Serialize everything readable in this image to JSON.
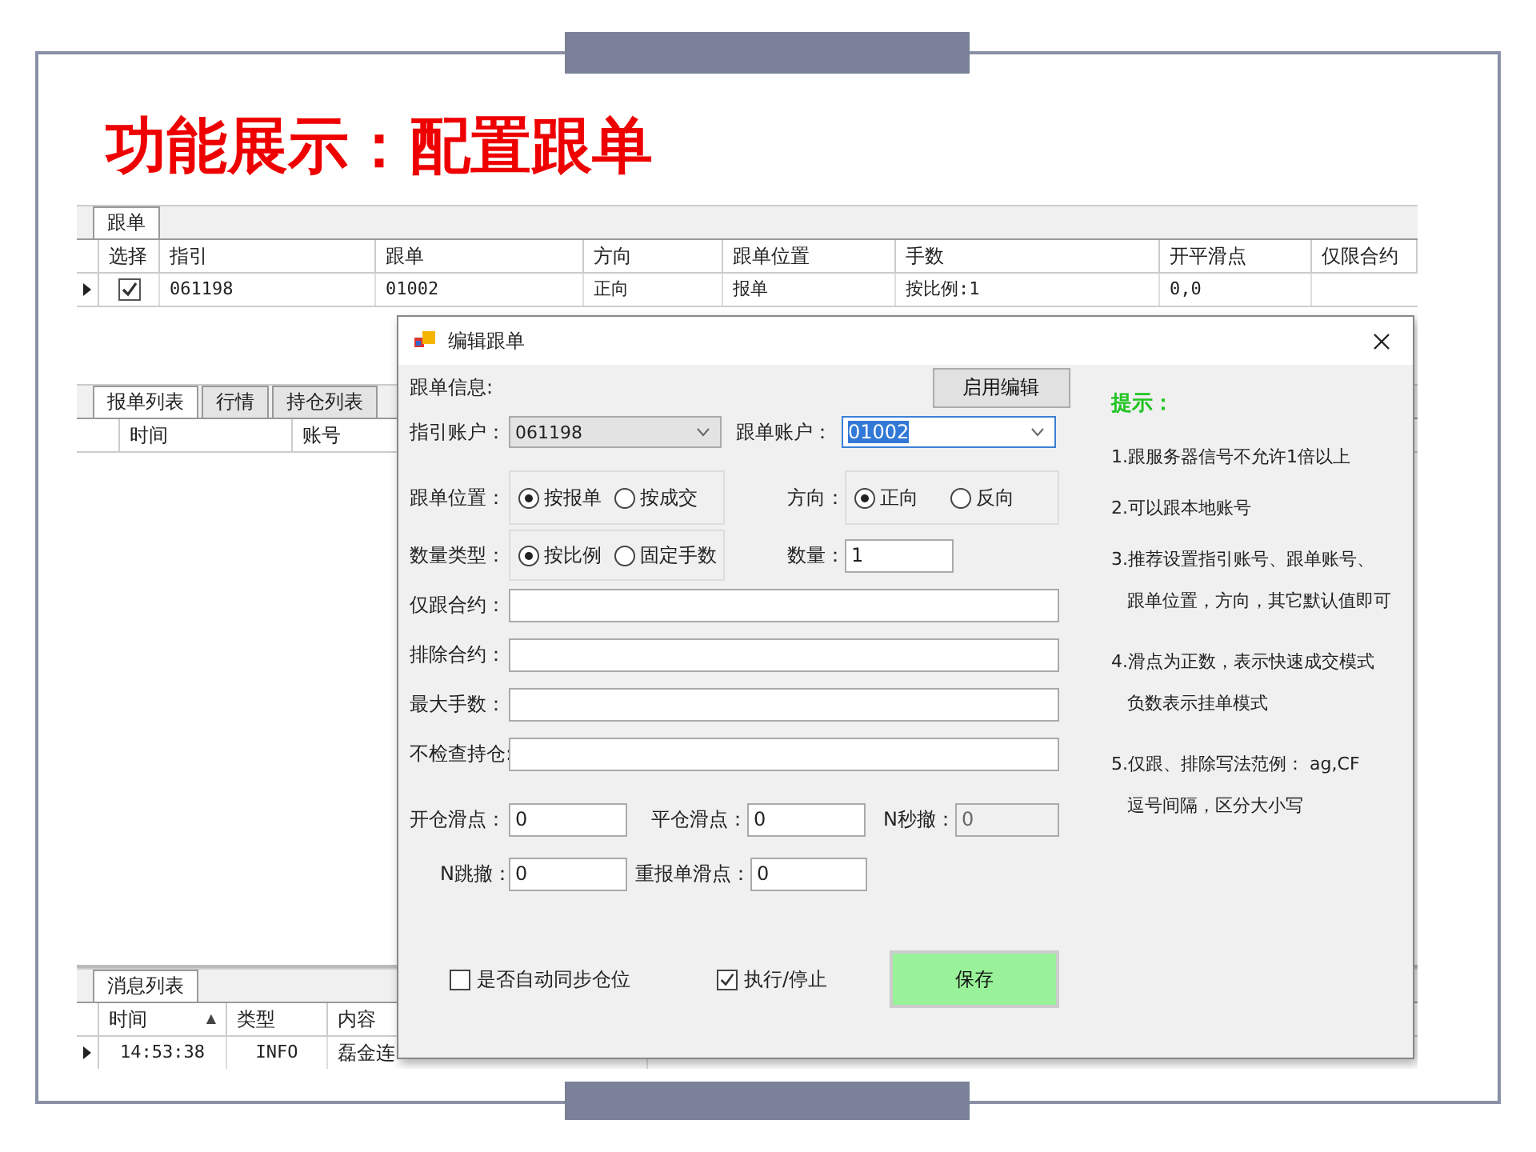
{
  "slide": {
    "title": "功能展示：配置跟单"
  },
  "app": {
    "top_tabs": [
      {
        "label": "跟单",
        "selected": true
      }
    ],
    "follow_table": {
      "select_column": "选择",
      "columns": [
        "指引",
        "跟单",
        "方向",
        "跟单位置",
        "手数",
        "开平滑点",
        "仅限合约"
      ],
      "rows": [
        {
          "selected": true,
          "checked": true,
          "cells": [
            "061198",
            "01002",
            "正向",
            "报单",
            "按比例:1",
            "0,0"
          ]
        }
      ]
    },
    "order_tabs": [
      {
        "label": "报单列表",
        "selected": true
      },
      {
        "label": "行情",
        "selected": false
      },
      {
        "label": "持仓列表",
        "selected": false
      }
    ],
    "order_table": {
      "columns": [
        "时间",
        "账号"
      ]
    },
    "message_tabs": [
      {
        "label": "消息列表",
        "selected": true
      }
    ],
    "message_table": {
      "columns": [
        {
          "label": "时间",
          "sort": "▲"
        },
        {
          "label": "类型"
        },
        {
          "label": "内容"
        }
      ],
      "rows": [
        {
          "selected": true,
          "cells": [
            "14:53:38",
            "INFO",
            "磊金连"
          ]
        }
      ]
    }
  },
  "dialog": {
    "title": "编辑跟单",
    "info_label": "跟单信息:",
    "enable_button": "启用编辑",
    "lead_account": {
      "label": "指引账户：",
      "value": "061198",
      "disabled": true
    },
    "follow_account": {
      "label": "跟单账户：",
      "value": "01002",
      "focused": true
    },
    "position": {
      "label": "跟单位置：",
      "options": [
        {
          "label": "按报单",
          "selected": true
        },
        {
          "label": "按成交",
          "selected": false
        }
      ]
    },
    "direction": {
      "label": "方向：",
      "options": [
        {
          "label": "正向",
          "selected": true
        },
        {
          "label": "反向",
          "selected": false
        }
      ]
    },
    "qty_type": {
      "label": "数量类型：",
      "options": [
        {
          "label": "按比例",
          "selected": true
        },
        {
          "label": "固定手数",
          "selected": false
        }
      ]
    },
    "quantity": {
      "label": "数量：",
      "value": "1"
    },
    "text_fields": [
      {
        "label": "仅跟合约："
      },
      {
        "label": "排除合约："
      },
      {
        "label": "最大手数："
      },
      {
        "label": "不检查持仓:"
      }
    ],
    "slip_rows": [
      [
        {
          "label": "开仓滑点：",
          "value": "0",
          "disabled": false
        },
        {
          "label": "平仓滑点：",
          "value": "0",
          "disabled": false
        },
        {
          "label": "N秒撤：",
          "value": "0",
          "disabled": true
        }
      ],
      [
        {
          "label": "N跳撤：",
          "value": "0",
          "disabled": false
        },
        {
          "label": "重报单滑点：",
          "value": "0",
          "disabled": false
        }
      ]
    ],
    "auto_sync": {
      "label": "是否自动同步仓位",
      "checked": false
    },
    "run_stop": {
      "label": "执行/停止",
      "checked": true
    },
    "save_button": "保存",
    "tips": {
      "title": "提示：",
      "items": [
        {
          "lines": [
            "1.跟服务器信号不允许1倍以上"
          ]
        },
        {
          "lines": [
            "2.可以跟本地账号"
          ]
        },
        {
          "lines": [
            "3.推荐设置指引账号、跟单账号、",
            "跟单位置，方向，其它默认值即可"
          ]
        },
        {
          "lines": [
            "4.滑点为正数，表示快速成交模式",
            "负数表示挂单模式"
          ]
        },
        {
          "lines": [
            "5.仅跟、排除写法范例： ag,CF",
            "逗号间隔，区分大小写"
          ]
        }
      ]
    }
  }
}
